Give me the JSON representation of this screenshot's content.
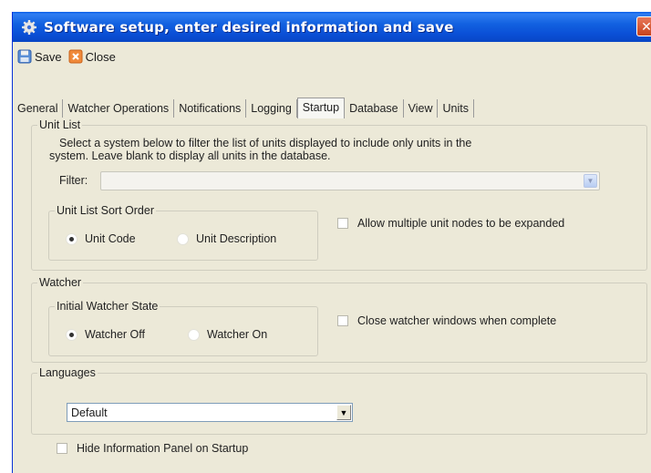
{
  "window": {
    "title": "Software setup, enter desired information and save",
    "icon": "gear-icon",
    "close_glyph": "✕"
  },
  "toolbar": {
    "save_label": "Save",
    "close_label": "Close"
  },
  "tabs": [
    {
      "label": "General",
      "active": false
    },
    {
      "label": "Watcher Operations",
      "active": false
    },
    {
      "label": "Notifications",
      "active": false
    },
    {
      "label": "Logging",
      "active": false
    },
    {
      "label": "Startup",
      "active": true
    },
    {
      "label": "Database",
      "active": false
    },
    {
      "label": "View",
      "active": false
    },
    {
      "label": "Units",
      "active": false
    }
  ],
  "unit_list": {
    "legend": "Unit List",
    "description_line1": "Select a system below to filter the list of units displayed to include only units in the",
    "description_line2": "system.  Leave blank to display all units in the database.",
    "filter_label": "Filter:",
    "filter_value": "",
    "sort_order": {
      "legend": "Unit List Sort Order",
      "options": [
        {
          "label": "Unit Code",
          "selected": true
        },
        {
          "label": "Unit Description",
          "selected": false
        }
      ]
    },
    "allow_multiple_label": "Allow multiple unit nodes to be expanded",
    "allow_multiple_checked": false
  },
  "watcher": {
    "legend": "Watcher",
    "initial_state": {
      "legend": "Initial Watcher State",
      "options": [
        {
          "label": "Watcher Off",
          "selected": true
        },
        {
          "label": "Watcher On",
          "selected": false
        }
      ]
    },
    "close_windows_label": "Close watcher windows when complete",
    "close_windows_checked": false
  },
  "languages": {
    "legend": "Languages",
    "selected": "Default"
  },
  "hide_info_panel_label": "Hide Information Panel on Startup",
  "hide_info_panel_checked": false
}
